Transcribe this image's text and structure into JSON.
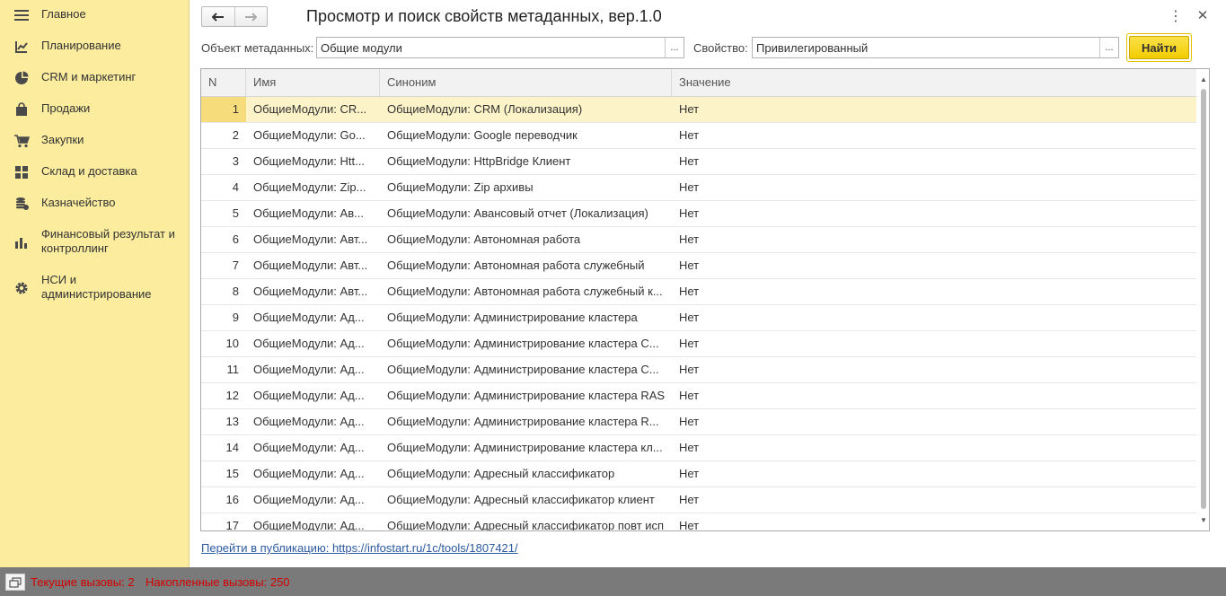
{
  "sidebar": {
    "items": [
      {
        "label": "Главное",
        "icon": "menu-icon"
      },
      {
        "label": "Планирование",
        "icon": "planning-icon"
      },
      {
        "label": "CRM и маркетинг",
        "icon": "pie-chart-icon"
      },
      {
        "label": "Продажи",
        "icon": "shopping-bag-icon"
      },
      {
        "label": "Закупки",
        "icon": "cart-icon"
      },
      {
        "label": "Склад и доставка",
        "icon": "grid-icon"
      },
      {
        "label": "Казначейство",
        "icon": "coins-icon"
      },
      {
        "label": "Финансовый результат и контроллинг",
        "icon": "bar-chart-icon"
      },
      {
        "label": "НСИ и администрирование",
        "icon": "gear-icon"
      }
    ]
  },
  "header": {
    "title": "Просмотр и поиск свойств метаданных, вер.1.0"
  },
  "form": {
    "object_label": "Объект метаданных:",
    "object_value": "Общие модули",
    "property_label": "Свойство:",
    "property_value": "Привилегированный",
    "select_label": "...",
    "find_label": "Найти"
  },
  "table": {
    "columns": [
      "N",
      "Имя",
      "Синоним",
      "Значение"
    ],
    "rows": [
      {
        "n": "1",
        "name": "ОбщиеМодули: CR...",
        "synonym": "ОбщиеМодули: CRM (Локализация)",
        "value": "Нет"
      },
      {
        "n": "2",
        "name": "ОбщиеМодули: Go...",
        "synonym": "ОбщиеМодули: Google переводчик",
        "value": "Нет"
      },
      {
        "n": "3",
        "name": "ОбщиеМодули: Htt...",
        "synonym": "ОбщиеМодули: HttpBridge Клиент",
        "value": "Нет"
      },
      {
        "n": "4",
        "name": "ОбщиеМодули: Zip...",
        "synonym": "ОбщиеМодули: Zip архивы",
        "value": "Нет"
      },
      {
        "n": "5",
        "name": "ОбщиеМодули: Ав...",
        "synonym": "ОбщиеМодули: Авансовый отчет (Локализация)",
        "value": "Нет"
      },
      {
        "n": "6",
        "name": "ОбщиеМодули: Авт...",
        "synonym": "ОбщиеМодули: Автономная работа",
        "value": "Нет"
      },
      {
        "n": "7",
        "name": "ОбщиеМодули: Авт...",
        "synonym": "ОбщиеМодули: Автономная работа служебный",
        "value": "Нет"
      },
      {
        "n": "8",
        "name": "ОбщиеМодули: Авт...",
        "synonym": "ОбщиеМодули: Автономная работа служебный к...",
        "value": "Нет"
      },
      {
        "n": "9",
        "name": "ОбщиеМодули: Ад...",
        "synonym": "ОбщиеМодули: Администрирование кластера",
        "value": "Нет"
      },
      {
        "n": "10",
        "name": "ОбщиеМодули: Ад...",
        "synonym": "ОбщиеМодули: Администрирование кластера С...",
        "value": "Нет"
      },
      {
        "n": "11",
        "name": "ОбщиеМодули: Ад...",
        "synonym": "ОбщиеМодули: Администрирование кластера С...",
        "value": "Нет"
      },
      {
        "n": "12",
        "name": "ОбщиеМодули: Ад...",
        "synonym": "ОбщиеМодули: Администрирование кластера RAS",
        "value": "Нет"
      },
      {
        "n": "13",
        "name": "ОбщиеМодули: Ад...",
        "synonym": "ОбщиеМодули: Администрирование кластера R...",
        "value": "Нет"
      },
      {
        "n": "14",
        "name": "ОбщиеМодули: Ад...",
        "synonym": "ОбщиеМодули: Администрирование кластера кл...",
        "value": "Нет"
      },
      {
        "n": "15",
        "name": "ОбщиеМодули: Ад...",
        "synonym": "ОбщиеМодули: Адресный классификатор",
        "value": "Нет"
      },
      {
        "n": "16",
        "name": "ОбщиеМодули: Ад...",
        "synonym": "ОбщиеМодули: Адресный классификатор клиент",
        "value": "Нет"
      },
      {
        "n": "17",
        "name": "ОбщиеМодули: Ад...",
        "synonym": "ОбщиеМодули: Адресный классификатор повт исп",
        "value": "Нет"
      }
    ]
  },
  "footer": {
    "link_prefix": "Перейти в публикацию:",
    "link_url": "https://infostart.ru/1c/tools/1807421/"
  },
  "status": {
    "current_calls": "Текущие вызовы: 2",
    "total_calls": "Накопленные вызовы: 250"
  },
  "colors": {
    "sidebar_bg": "#fbec9e",
    "accent_button": "#f2cc00",
    "selected_row": "#fcf3c8",
    "status_text": "#d40000",
    "link": "#2c5aa0"
  }
}
